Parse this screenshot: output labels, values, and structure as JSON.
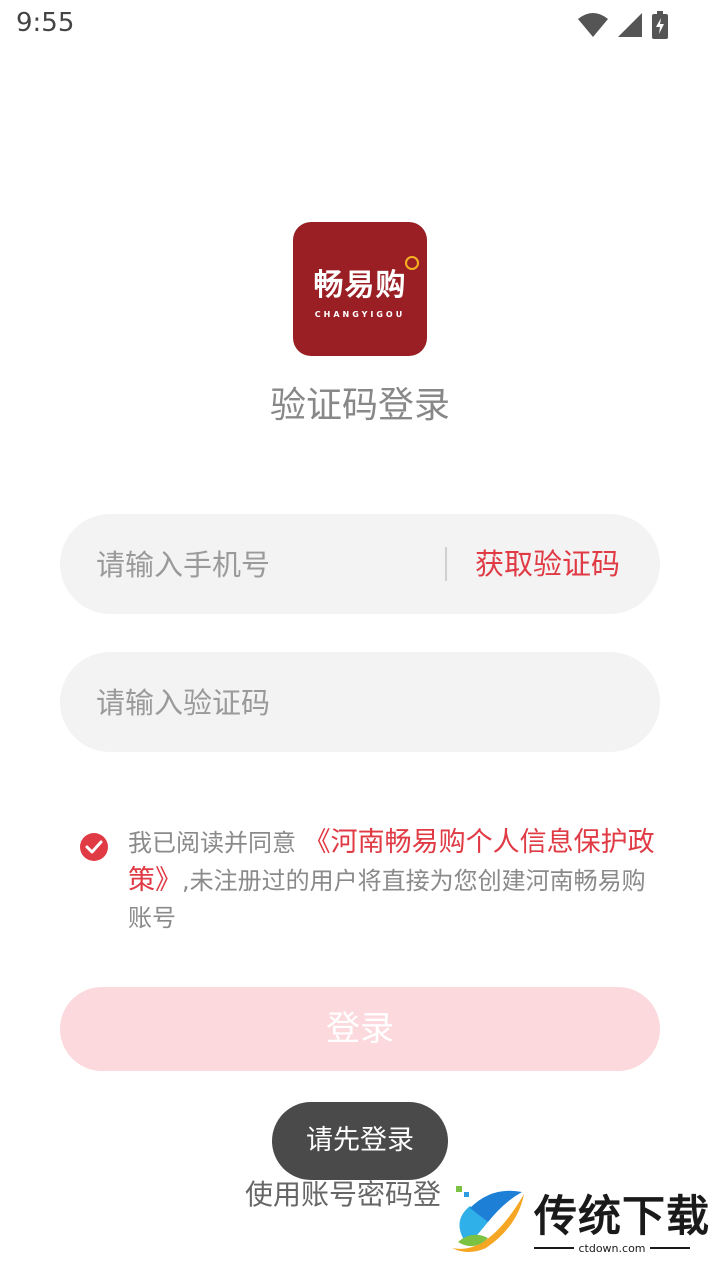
{
  "status_bar": {
    "time": "9:55",
    "icons": [
      "wifi-icon",
      "signal-icon",
      "battery-charging-icon"
    ]
  },
  "logo": {
    "text_cn": "畅易购",
    "text_en": "CHANGYIGOU",
    "background": "#9a1f24"
  },
  "page_title": "验证码登录",
  "phone_input": {
    "placeholder": "请输入手机号",
    "value": ""
  },
  "get_code_label": "获取验证码",
  "code_input": {
    "placeholder": "请输入验证码",
    "value": ""
  },
  "agreement": {
    "checked": true,
    "prefix": "我已阅读并同意",
    "link": "《河南畅易购个人信息保护政策》",
    "suffix": ",未注册过的用户将直接为您创建河南畅易购账号"
  },
  "login_button_label": "登录",
  "password_login_label": "使用账号密码登录",
  "toast": "请先登录",
  "watermark": {
    "text": "传统下载",
    "sub": "ctdown.com"
  },
  "colors": {
    "accent": "#e03a45",
    "login_button_disabled": "#fcd9dc",
    "field_background": "#f3f3f3"
  }
}
